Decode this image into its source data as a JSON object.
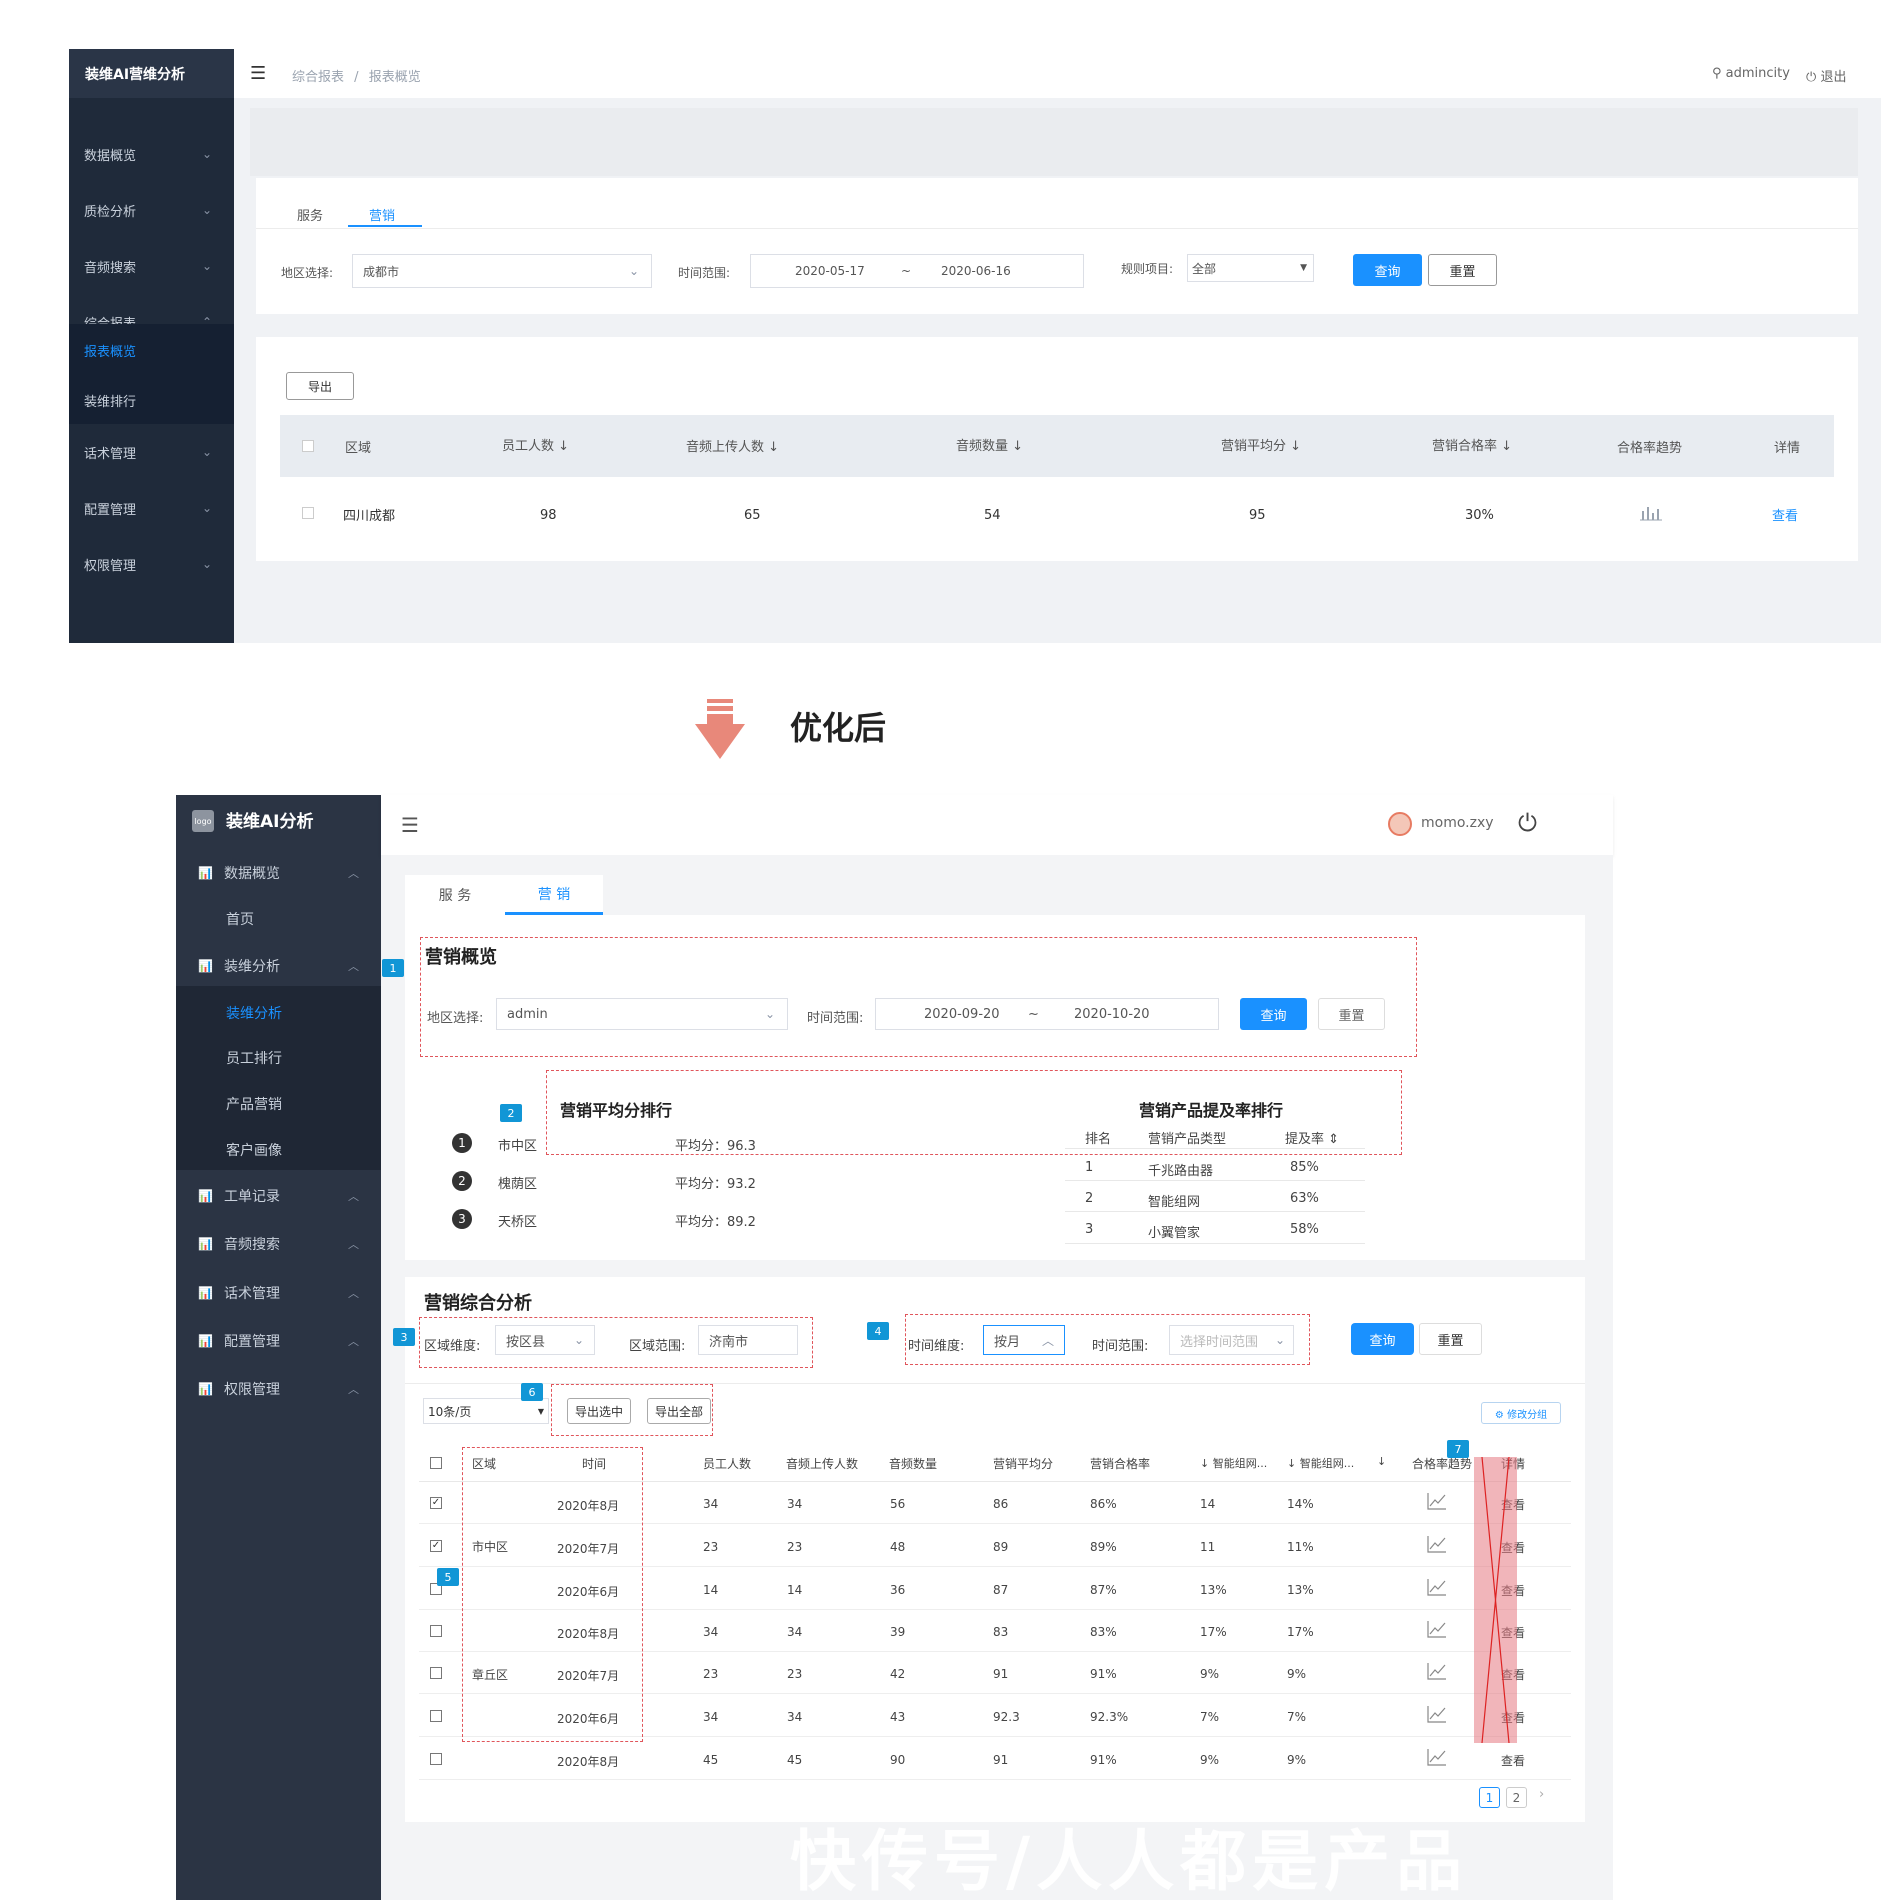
{
  "top": {
    "logo": "装维AI营维分析",
    "breadcrumb": [
      "综合报表",
      "报表概览"
    ],
    "breadcrumb_sep": "/",
    "user": "admincity",
    "logout": "退出",
    "menu": [
      "数据概览",
      "质检分析",
      "音频搜索",
      "综合报表",
      "报表概览",
      "装维排行",
      "话术管理",
      "配置管理",
      "权限管理"
    ],
    "tabs": [
      "服务",
      "营销"
    ],
    "filters": {
      "region_label": "地区选择:",
      "region_value": "成都市",
      "time_label": "时间范围:",
      "time_start": "2020-05-17",
      "time_sep": "~",
      "time_end": "2020-06-16",
      "rule_label": "规则项目:",
      "rule_value": "全部",
      "query": "查询",
      "reset": "重置"
    },
    "export": "导出",
    "table": {
      "headers": [
        "区域",
        "员工人数 ↓",
        "音频上传人数 ↓",
        "音频数量 ↓",
        "营销平均分 ↓",
        "营销合格率 ↓",
        "合格率趋势",
        "详情"
      ],
      "row": [
        "四川成都",
        "98",
        "65",
        "54",
        "95",
        "30%",
        "",
        "查看"
      ]
    }
  },
  "after_label": "优化后",
  "bottom": {
    "logo_box": "logo",
    "logo": "装维AI分析",
    "user": "momo.zxy",
    "menu": {
      "data": "数据概览",
      "home": "首页",
      "zw": "装维分析",
      "zw_sub": "装维分析",
      "staff": "员工排行",
      "product": "产品营销",
      "profile": "客户画像",
      "work": "工单记录",
      "audio": "音频搜索",
      "script": "话术管理",
      "config": "配置管理",
      "perm": "权限管理"
    },
    "tabs": [
      "服 务",
      "营 销"
    ],
    "overview": {
      "title": "营销概览",
      "region_label": "地区选择:",
      "region_value": "admin",
      "time_label": "时间范围:",
      "time_start": "2020-09-20",
      "time_sep": "~",
      "time_end": "2020-10-20",
      "query": "查询",
      "reset": "重置"
    },
    "ranking": {
      "title": "营销平均分排行",
      "items": [
        {
          "no": "1",
          "area": "市中区",
          "score": "平均分：96.3"
        },
        {
          "no": "2",
          "area": "槐荫区",
          "score": "平均分：93.2"
        },
        {
          "no": "3",
          "area": "天桥区",
          "score": "平均分：89.2"
        }
      ]
    },
    "product": {
      "title": "营销产品提及率排行",
      "headers": [
        "排名",
        "营销产品类型",
        "提及率 ⇕"
      ],
      "rows": [
        [
          "1",
          "千兆路由器",
          "85%"
        ],
        [
          "2",
          "智能组网",
          "63%"
        ],
        [
          "3",
          "小翼管家",
          "58%"
        ]
      ]
    },
    "analysis": {
      "title": "营销综合分析",
      "dim_label": "区域维度:",
      "dim_value": "按区县",
      "range_label": "区域范围:",
      "range_value": "济南市",
      "time_dim_label": "时间维度:",
      "time_dim_value": "按月",
      "time_range_label": "时间范围:",
      "time_range_placeholder": "选择时间范围",
      "query": "查询",
      "reset": "重置",
      "page_size": "10条/页",
      "export_selected": "导出选中",
      "export_all": "导出全部",
      "group_btn": "⚙ 修改分组"
    },
    "table": {
      "headers": [
        "区域",
        "时间",
        "员工人数",
        "音频上传人数",
        "音频数量",
        "营销平均分",
        "营销合格率",
        "↓ 智能组网...",
        "↓ 智能组网...",
        "↓",
        "合格率趋势",
        "详情"
      ],
      "rows": [
        {
          "checked": true,
          "time": "2020年8月",
          "v": [
            "34",
            "34",
            "56",
            "86",
            "86%",
            "14",
            "14%"
          ]
        },
        {
          "checked": true,
          "time": "2020年7月",
          "v": [
            "23",
            "23",
            "48",
            "89",
            "89%",
            "11",
            "11%"
          ]
        },
        {
          "checked": false,
          "time": "2020年6月",
          "v": [
            "14",
            "14",
            "36",
            "87",
            "87%",
            "13%",
            "13%"
          ]
        },
        {
          "checked": false,
          "time": "2020年8月",
          "v": [
            "34",
            "34",
            "39",
            "83",
            "83%",
            "17%",
            "17%"
          ]
        },
        {
          "checked": false,
          "time": "2020年7月",
          "v": [
            "23",
            "23",
            "42",
            "91",
            "91%",
            "9%",
            "9%"
          ]
        },
        {
          "checked": false,
          "time": "2020年6月",
          "v": [
            "34",
            "34",
            "43",
            "92.3",
            "92.3%",
            "7%",
            "7%"
          ]
        },
        {
          "checked": false,
          "time": "2020年8月",
          "v": [
            "45",
            "45",
            "90",
            "91",
            "91%",
            "9%",
            "9%"
          ]
        }
      ],
      "areas": [
        "市中区",
        "章丘区"
      ],
      "detail": "查看",
      "pages": [
        "1",
        "2"
      ]
    },
    "badges": [
      "1",
      "2",
      "3",
      "4",
      "5",
      "6",
      "7"
    ]
  },
  "watermark": "快传号/人人都是产品",
  "colors": {
    "accent": "#1a91ff",
    "sidebar": "#1f2a3a",
    "dash": "#e0555b",
    "badge": "#1196d6"
  }
}
